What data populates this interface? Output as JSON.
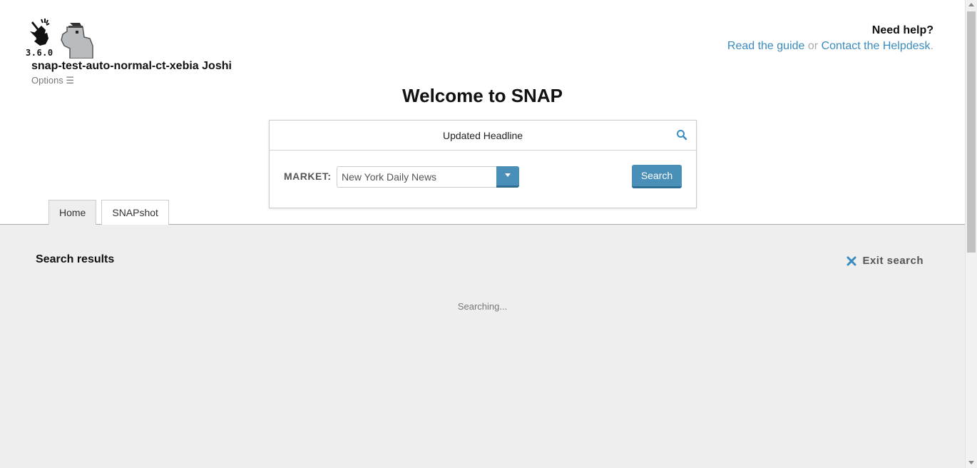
{
  "header": {
    "version": "3.6.0",
    "username": "snap-test-auto-normal-ct-xebia Joshi",
    "options_label": "Options ☰",
    "logo_icon": "snapping-hand-icon",
    "mascot_icon": "dinosaur-mascot-icon"
  },
  "help": {
    "title": "Need help?",
    "guide_link": "Read the guide",
    "separator": "or",
    "helpdesk_link": "Contact the Helpdesk",
    "trailing": "."
  },
  "welcome": "Welcome to SNAP",
  "search": {
    "headline_value": "Updated Headline",
    "headline_icon": "search-icon",
    "market_label": "MARKET:",
    "market_value": "New York Daily News",
    "search_button": "Search"
  },
  "tabs": [
    {
      "label": "Home",
      "active": true
    },
    {
      "label": "SNAPshot",
      "active": false
    }
  ],
  "results": {
    "title": "Search results",
    "exit_label": "Exit search",
    "status": "Searching..."
  },
  "colors": {
    "accent": "#4a8fb8",
    "link": "#3a8bbf",
    "panel_bg": "#eeeeee"
  }
}
